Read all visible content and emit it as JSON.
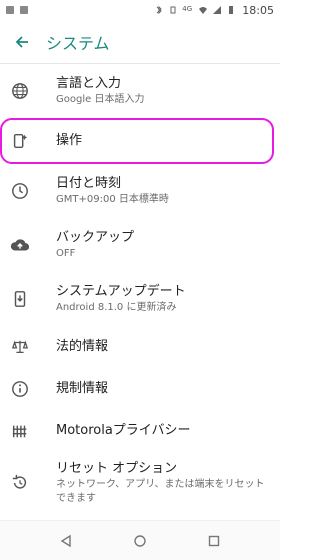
{
  "status_bar": {
    "time": "18:05",
    "network": "4G"
  },
  "app_bar": {
    "title": "システム"
  },
  "items": [
    {
      "label": "言語と入力",
      "sub": "Google 日本語入力",
      "icon": "globe-icon"
    },
    {
      "label": "操作",
      "sub": "",
      "icon": "phone-sparkle-icon"
    },
    {
      "label": "日付と時刻",
      "sub": "GMT+09:00 日本標準時",
      "icon": "clock-icon"
    },
    {
      "label": "バックアップ",
      "sub": "OFF",
      "icon": "cloud-upload-icon"
    },
    {
      "label": "システムアップデート",
      "sub": "Android 8.1.0 に更新済み",
      "icon": "system-update-icon"
    },
    {
      "label": "法的情報",
      "sub": "",
      "icon": "scales-icon"
    },
    {
      "label": "規制情報",
      "sub": "",
      "icon": "info-icon"
    },
    {
      "label": "Motorolaプライバシー",
      "sub": "",
      "icon": "fence-icon"
    },
    {
      "label": "リセット オプション",
      "sub": "ネットワーク、アプリ、または端末をリセットできます",
      "icon": "reset-icon"
    }
  ],
  "colors": {
    "accent": "#1a8a7f",
    "highlight": "#e61be0"
  }
}
